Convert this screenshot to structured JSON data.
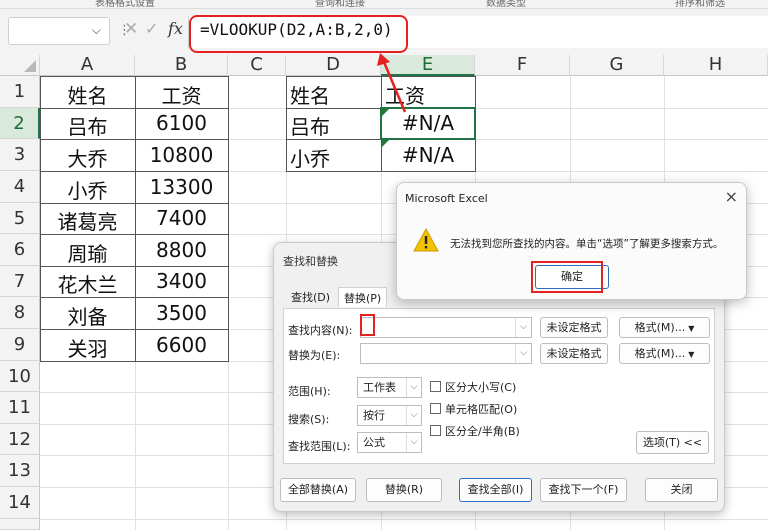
{
  "ribbon_cutoff_labels": [
    "表格格式设置",
    "查询和连接",
    "数据类型",
    "排序和筛选"
  ],
  "formula_bar": {
    "name_box_value": "",
    "fx_label": "fx",
    "formula": "=VLOOKUP(D2,A:B,2,0)"
  },
  "columns": [
    "A",
    "B",
    "C",
    "D",
    "E",
    "F",
    "G",
    "H"
  ],
  "rows": [
    "1",
    "2",
    "3",
    "4",
    "5",
    "6",
    "7",
    "8",
    "9",
    "10",
    "11",
    "12",
    "13",
    "14"
  ],
  "table1": {
    "header": [
      "姓名",
      "工资"
    ],
    "rows": [
      [
        "吕布",
        "6100"
      ],
      [
        "大乔",
        "10800"
      ],
      [
        "小乔",
        "13300"
      ],
      [
        "诸葛亮",
        "7400"
      ],
      [
        "周瑜",
        "8800"
      ],
      [
        "花木兰",
        "3400"
      ],
      [
        "刘备",
        "3500"
      ],
      [
        "关羽",
        "6600"
      ]
    ]
  },
  "table2": {
    "header": [
      "姓名",
      "工资"
    ],
    "rows": [
      [
        "吕布",
        "#N/A"
      ],
      [
        "小乔",
        "#N/A"
      ]
    ]
  },
  "find_replace": {
    "title": "查找和替换",
    "tabs": [
      "查找(D)",
      "替换(P)"
    ],
    "find_label": "查找内容(N):",
    "replace_label": "替换为(E):",
    "find_value": "",
    "replace_value": "",
    "no_format": "未设定格式",
    "format_btn": "格式(M)...",
    "scope_label": "范围(H):",
    "scope_value": "工作表",
    "search_label": "搜索(S):",
    "search_value": "按行",
    "lookin_label": "查找范围(L):",
    "lookin_value": "公式",
    "case_label": "区分大小写(C)",
    "cell_match_label": "单元格匹配(O)",
    "width_label": "区分全/半角(B)",
    "options_btn": "选项(T) <<",
    "replace_all_btn": "全部替换(A)",
    "replace_btn": "替换(R)",
    "find_all_btn": "查找全部(I)",
    "find_next_btn": "查找下一个(F)",
    "close_btn": "关闭"
  },
  "message_box": {
    "title": "Microsoft Excel",
    "text": "无法找到您所查找的内容。单击“选项”了解更多搜索方式。",
    "ok": "确定",
    "close_icon": "×"
  },
  "colors": {
    "annotation_red": "#e52222",
    "excel_green": "#217346"
  }
}
